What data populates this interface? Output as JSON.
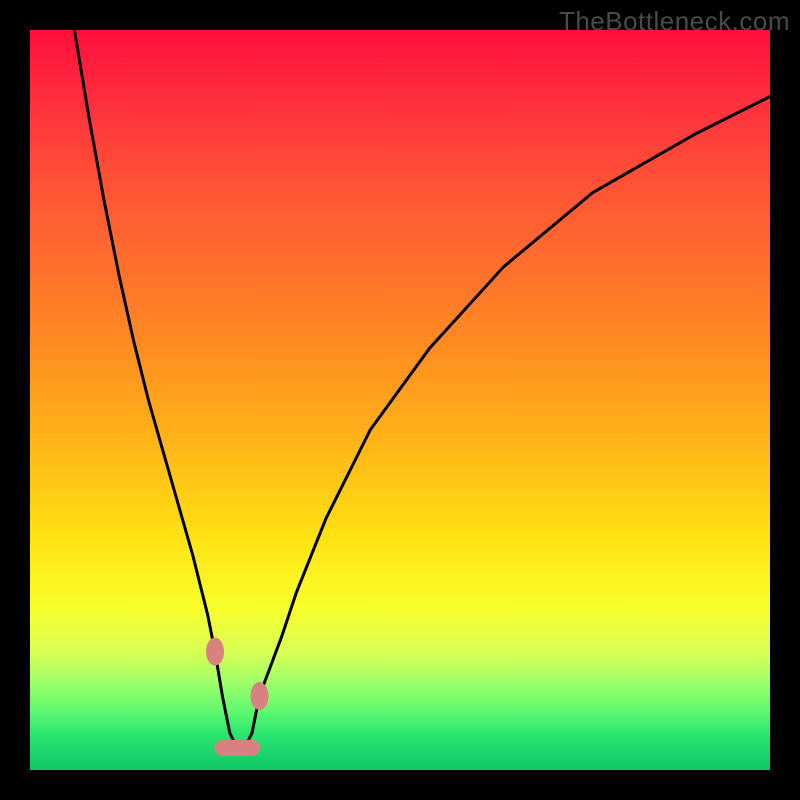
{
  "watermark": "TheBottleneck.com",
  "chart_data": {
    "type": "line",
    "title": "",
    "xlabel": "",
    "ylabel": "",
    "xlim": [
      0,
      100
    ],
    "ylim": [
      0,
      100
    ],
    "series": [
      {
        "name": "bottleneck-curve",
        "x": [
          6,
          8,
          10,
          12,
          14,
          16,
          18,
          20,
          22,
          24,
          25,
          26,
          27,
          28,
          29,
          30,
          31,
          34,
          36,
          40,
          46,
          54,
          64,
          76,
          90,
          100
        ],
        "values": [
          100,
          88,
          77,
          67,
          58,
          50,
          43,
          36,
          29,
          21,
          16,
          10,
          5,
          3,
          3,
          5,
          10,
          18,
          24,
          34,
          46,
          57,
          68,
          78,
          86,
          91
        ]
      }
    ],
    "markers": [
      {
        "name": "marker-left",
        "x": 25.0,
        "y": 16,
        "color": "#d98080"
      },
      {
        "name": "marker-right",
        "x": 31.0,
        "y": 10,
        "color": "#d98080"
      }
    ],
    "bottom_segment": {
      "x_start": 26,
      "x_end": 30,
      "y": 3,
      "color": "#d98080"
    }
  }
}
